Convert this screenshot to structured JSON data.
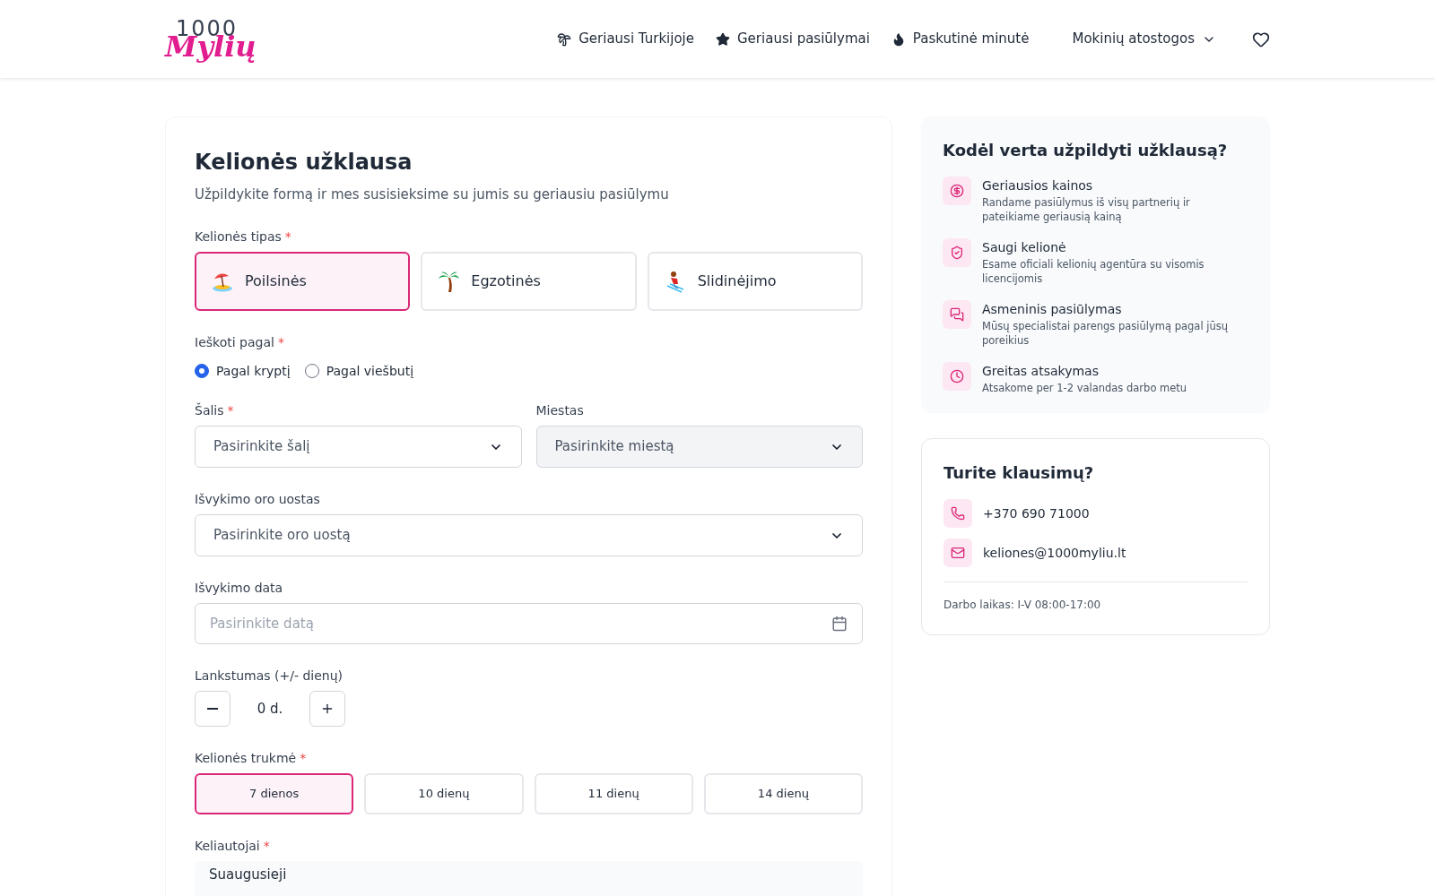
{
  "header": {
    "logo": {
      "number": "1000",
      "word": "Mylių"
    },
    "nav": [
      {
        "label": "Geriausi Turkijoje",
        "kind": "palm"
      },
      {
        "label": "Geriausi pasiūlymai",
        "kind": "star"
      },
      {
        "label": "Paskutinė minutė",
        "kind": "fire"
      },
      {
        "label": "Mokinių atostogos",
        "kind": "dropdown"
      }
    ]
  },
  "form": {
    "title": "Kelionės užklausa",
    "subtitle": "Užpildykite formą ir mes susisieksime su jumis su geriausiu pasiūlymu",
    "required_mark": "*",
    "trip_type": {
      "label": "Kelionės tipas",
      "options": [
        {
          "label": "Poilsinės",
          "kind": "beach",
          "selected": true
        },
        {
          "label": "Egzotinės",
          "kind": "palm",
          "selected": false
        },
        {
          "label": "Slidinėjimo",
          "kind": "ski",
          "selected": false
        }
      ]
    },
    "search_by": {
      "label": "Ieškoti pagal",
      "options": [
        {
          "label": "Pagal kryptį",
          "selected": true
        },
        {
          "label": "Pagal viešbutį",
          "selected": false
        }
      ]
    },
    "country": {
      "label": "Šalis",
      "required": true,
      "value": "Pasirinkite šalį",
      "disabled": false
    },
    "city": {
      "label": "Miestas",
      "required": false,
      "value": "Pasirinkite miestą",
      "disabled": true
    },
    "airport": {
      "label": "Išvykimo oro uostas",
      "value": "Pasirinkite oro uostą"
    },
    "date": {
      "label": "Išvykimo data",
      "placeholder": "Pasirinkite datą"
    },
    "flexibility": {
      "label": "Lankstumas (+/- dienų)",
      "value": "0 d."
    },
    "duration": {
      "label": "Kelionės trukmė",
      "options": [
        {
          "label": "7 dienos",
          "selected": true
        },
        {
          "label": "10 dienų",
          "selected": false
        },
        {
          "label": "11 dienų",
          "selected": false
        },
        {
          "label": "14 dienų",
          "selected": false
        }
      ]
    },
    "travelers": {
      "label": "Keliautojai",
      "rows": [
        {
          "label": "Suaugusieji"
        }
      ]
    }
  },
  "why": {
    "title": "Kodėl verta užpildyti užklausą?",
    "items": [
      {
        "title": "Geriausios kainos",
        "text": "Randame pasiūlymus iš visų partnerių ir pateikiame geriausią kainą",
        "kind": "dollar"
      },
      {
        "title": "Saugi kelionė",
        "text": "Esame oficiali kelionių agentūra su visomis licencijomis",
        "kind": "shield"
      },
      {
        "title": "Asmeninis pasiūlymas",
        "text": "Mūsų specialistai parengs pasiūlymą pagal jūsų poreikius",
        "kind": "chat"
      },
      {
        "title": "Greitas atsakymas",
        "text": "Atsakome per 1-2 valandas darbo metu",
        "kind": "clock"
      }
    ]
  },
  "contact": {
    "title": "Turite klausimų?",
    "items": [
      {
        "text": "+370 690 71000",
        "kind": "phone"
      },
      {
        "text": "keliones@1000myliu.lt",
        "kind": "mail"
      }
    ],
    "hours": "Darbo laikas: I-V 08:00-17:00"
  }
}
